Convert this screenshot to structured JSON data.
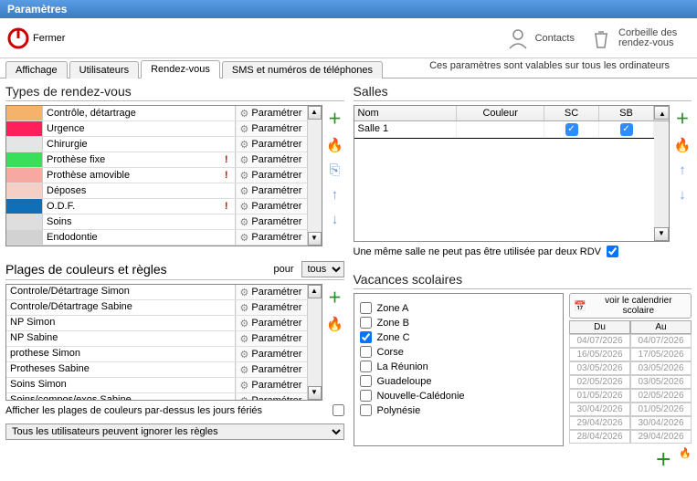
{
  "window": {
    "title": "Paramètres"
  },
  "toolbar": {
    "close": "Fermer",
    "contacts": "Contacts",
    "trash": "Corbeille des rendez-vous"
  },
  "tabs": [
    "Affichage",
    "Utilisateurs",
    "Rendez-vous",
    "SMS et numéros de téléphones"
  ],
  "subtitle": "Ces paramètres sont valables sur tous les ordinateurs",
  "param_label": "Paramétrer",
  "types": {
    "title": "Types de rendez-vous",
    "rows": [
      {
        "color": "#f5b26b",
        "label": "Contrôle, détartrage",
        "warn": false
      },
      {
        "color": "#ff1f5a",
        "label": "Urgence",
        "warn": false
      },
      {
        "color": "#e5e5e5",
        "label": "Chirurgie",
        "warn": false
      },
      {
        "color": "#36e05a",
        "label": "Prothèse fixe",
        "warn": true
      },
      {
        "color": "#f7a8a0",
        "label": "Prothèse amovible",
        "warn": true
      },
      {
        "color": "#f3cfc6",
        "label": "Déposes",
        "warn": false
      },
      {
        "color": "#0f6fb8",
        "label": "O.D.F.",
        "warn": true
      },
      {
        "color": "#dedede",
        "label": "Soins",
        "warn": false
      },
      {
        "color": "#d2d2d2",
        "label": "Endodontie",
        "warn": false
      }
    ]
  },
  "plages": {
    "title": "Plages de couleurs et règles",
    "pour": "pour",
    "select": "tous",
    "rows": [
      "Controle/Détartrage Simon",
      "Controle/Détartrage Sabine",
      "NP Simon",
      "NP Sabine",
      "prothese Simon",
      "Protheses Sabine",
      "Soins Simon",
      "Soins/compos/exos Sabine"
    ],
    "check_label": "Afficher les plages de couleurs par-dessus les jours fériés",
    "rule_select": "Tous les utilisateurs peuvent ignorer les règles"
  },
  "salles": {
    "title": "Salles",
    "head": {
      "nom": "Nom",
      "couleur": "Couleur",
      "sc": "SC",
      "sb": "SB"
    },
    "rows": [
      {
        "nom": "Salle 1",
        "sc": true,
        "sb": true
      }
    ],
    "note": "Une même salle ne peut pas être utilisée par deux RDV"
  },
  "vacances": {
    "title": "Vacances scolaires",
    "zones": [
      {
        "label": "Zone A",
        "checked": false
      },
      {
        "label": "Zone B",
        "checked": false
      },
      {
        "label": "Zone C",
        "checked": true
      },
      {
        "label": "Corse",
        "checked": false
      },
      {
        "label": "La Réunion",
        "checked": false
      },
      {
        "label": "Guadeloupe",
        "checked": false
      },
      {
        "label": "Nouvelle-Calédonie",
        "checked": false
      },
      {
        "label": "Polynésie",
        "checked": false
      }
    ],
    "calendar_btn": "voir le calendrier scolaire",
    "head": {
      "du": "Du",
      "au": "Au"
    },
    "dates": [
      [
        "04/07/2026",
        "04/07/2026"
      ],
      [
        "16/05/2026",
        "17/05/2026"
      ],
      [
        "03/05/2026",
        "03/05/2026"
      ],
      [
        "02/05/2026",
        "03/05/2026"
      ],
      [
        "01/05/2026",
        "02/05/2026"
      ],
      [
        "30/04/2026",
        "01/05/2026"
      ],
      [
        "29/04/2026",
        "30/04/2026"
      ],
      [
        "28/04/2026",
        "29/04/2026"
      ]
    ]
  }
}
